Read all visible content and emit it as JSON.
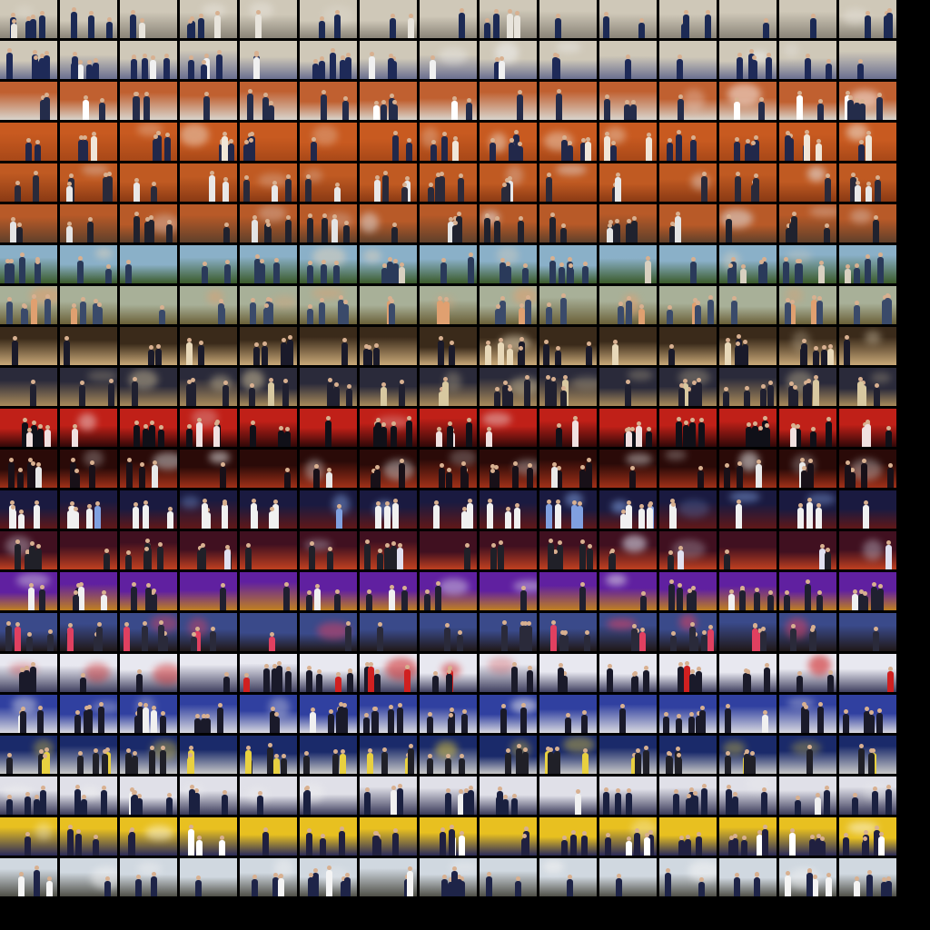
{
  "grid": {
    "columns": 15,
    "rows": 22
  },
  "background": "#000000",
  "row_palettes": [
    {
      "scene": "award-ceremony-indoor",
      "bg_top": "#cfc8b8",
      "bg_bottom": "#8a8478",
      "figure": "#1c2a55",
      "accent": "#e8e4dc"
    },
    {
      "scene": "award-ceremony-group",
      "bg_top": "#cfc8b8",
      "bg_bottom": "#6a6f90",
      "figure": "#1e2a58",
      "accent": "#f0f0f0"
    },
    {
      "scene": "banquet-hall",
      "bg_top": "#c06030",
      "bg_bottom": "#d8d4cc",
      "figure": "#242c4a",
      "accent": "#ffffff"
    },
    {
      "scene": "staff-portrait-orange-curtain",
      "bg_top": "#c85a20",
      "bg_bottom": "#a84818",
      "figure": "#22284a",
      "accent": "#f0e6d8"
    },
    {
      "scene": "staff-portrait-orange-curtain",
      "bg_top": "#c05a22",
      "bg_bottom": "#8a3a14",
      "figure": "#2a2a3a",
      "accent": "#e8e8e8"
    },
    {
      "scene": "group-photo-stage",
      "bg_top": "#b85a28",
      "bg_bottom": "#60402a",
      "figure": "#20222e",
      "accent": "#e4e4e4"
    },
    {
      "scene": "outdoor-hike",
      "bg_top": "#8ab0c8",
      "bg_bottom": "#3a5a2a",
      "figure": "#2a3a5a",
      "accent": "#d8d0c0"
    },
    {
      "scene": "tree-planting",
      "bg_top": "#a8b098",
      "bg_bottom": "#6a6038",
      "figure": "#3a4a6a",
      "accent": "#e0a070"
    },
    {
      "scene": "exhibition-booth",
      "bg_top": "#3a2a1a",
      "bg_bottom": "#c8a878",
      "figure": "#1a1a2a",
      "accent": "#e8d8b8"
    },
    {
      "scene": "exhibition-hall",
      "bg_top": "#2a2a3a",
      "bg_bottom": "#a88a5a",
      "figure": "#202030",
      "accent": "#d8c8a0"
    },
    {
      "scene": "concert-stage-red",
      "bg_top": "#c02018",
      "bg_bottom": "#300808",
      "figure": "#101018",
      "accent": "#f0e0e0"
    },
    {
      "scene": "concert-stage-dark",
      "bg_top": "#2a0a08",
      "bg_bottom": "#a03018",
      "figure": "#181018",
      "accent": "#e8e8e8"
    },
    {
      "scene": "concert-spotlight",
      "bg_top": "#1a1a40",
      "bg_bottom": "#601818",
      "figure": "#f0f0f0",
      "accent": "#80a0e0"
    },
    {
      "scene": "concert-smoke",
      "bg_top": "#401020",
      "bg_bottom": "#c04020",
      "figure": "#202028",
      "accent": "#e0e0f0"
    },
    {
      "scene": "concert-purple-lights",
      "bg_top": "#6020a0",
      "bg_bottom": "#c08020",
      "figure": "#202030",
      "accent": "#f0f0f0"
    },
    {
      "scene": "outdoor-festival",
      "bg_top": "#3a4a8a",
      "bg_bottom": "#201818",
      "figure": "#2a2a3a",
      "accent": "#e04060"
    },
    {
      "scene": "choir-and-speaker",
      "bg_top": "#e8e8f0",
      "bg_bottom": "#404060",
      "figure": "#1a1a2a",
      "accent": "#d02020"
    },
    {
      "scene": "conference-banner",
      "bg_top": "#3040a0",
      "bg_bottom": "#d8d8e0",
      "figure": "#1a1a2a",
      "accent": "#f0f0f0"
    },
    {
      "scene": "conference-podium",
      "bg_top": "#1a2a6a",
      "bg_bottom": "#c8c8c8",
      "figure": "#202028",
      "accent": "#e8d040"
    },
    {
      "scene": "seminar-room",
      "bg_top": "#e0e0e8",
      "bg_bottom": "#3a3a5a",
      "figure": "#1a2040",
      "accent": "#f0f0f0"
    },
    {
      "scene": "press-conference-yellow",
      "bg_top": "#e8c020",
      "bg_bottom": "#2a2a5a",
      "figure": "#202040",
      "accent": "#ffffff"
    },
    {
      "scene": "outdoor-visit",
      "bg_top": "#d0d8e0",
      "bg_bottom": "#505048",
      "figure": "#1e2448",
      "accent": "#f4f4f4"
    }
  ]
}
